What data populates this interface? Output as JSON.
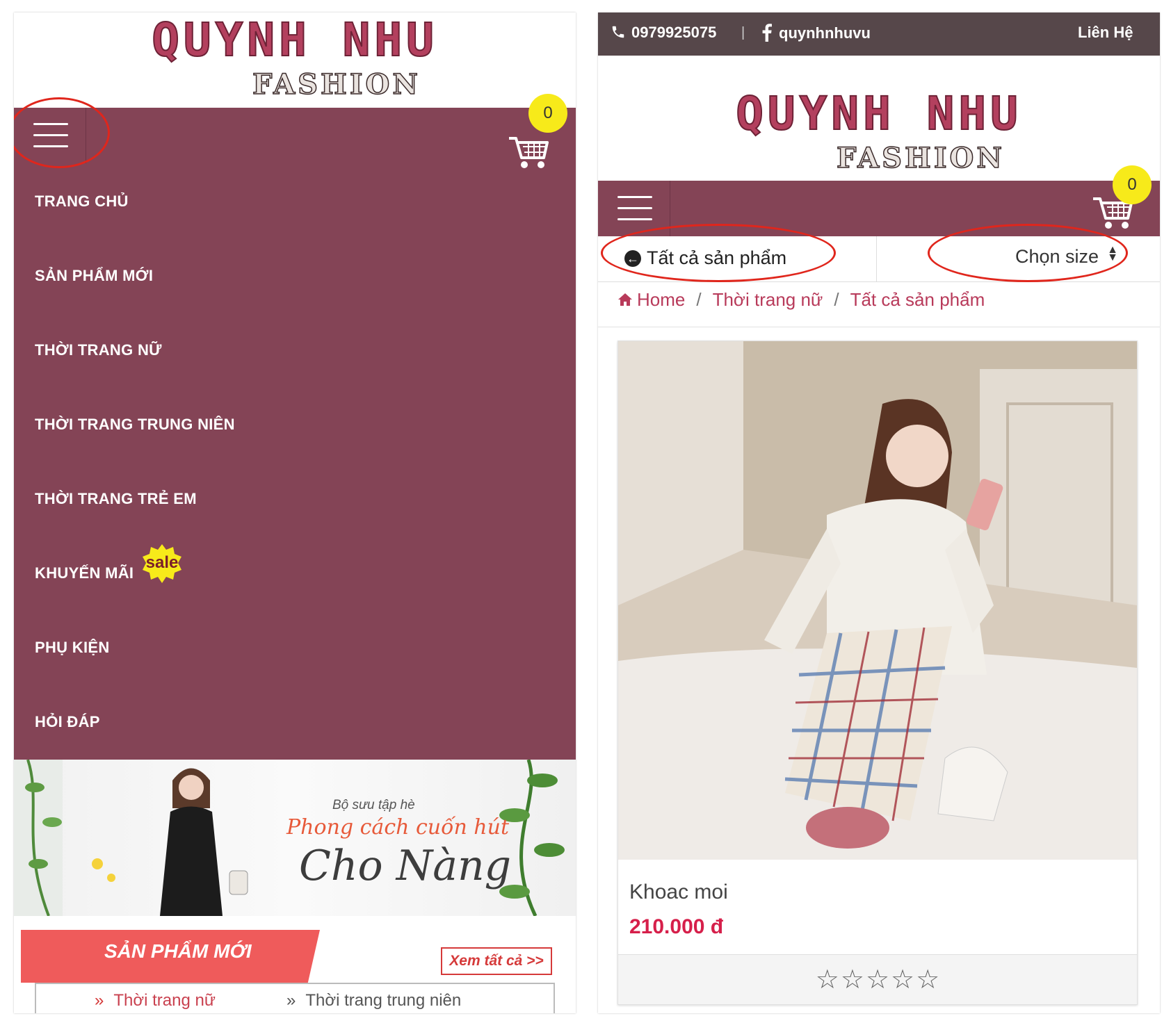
{
  "brand": {
    "logo_main": "QUYNH NHU",
    "logo_sub": "FASHION",
    "primary_color": "#844456",
    "accent_color": "#ef5b5b",
    "price_color": "#d61f4a"
  },
  "left": {
    "cart_count": "0",
    "menu": [
      {
        "label": "TRANG CHỦ"
      },
      {
        "label": "SẢN PHẨM MỚI"
      },
      {
        "label": "THỜI TRANG NỮ"
      },
      {
        "label": "THỜI TRANG TRUNG NIÊN"
      },
      {
        "label": "THỜI TRANG TRẺ EM"
      },
      {
        "label": "KHUYẾN MÃI",
        "badge": "sale"
      },
      {
        "label": "PHỤ KIỆN"
      },
      {
        "label": "HỎI ĐÁP"
      }
    ],
    "banner": {
      "kicker": "Bộ sưu tập hè",
      "line1": "Phong cách cuốn hút",
      "line2": "Cho Nàng"
    },
    "section": {
      "title": "SẢN PHẨM MỚI",
      "view_all": "Xem tất cả >>",
      "tabs": [
        {
          "label": "Thời trang nữ"
        },
        {
          "label": "Thời trang trung niên"
        }
      ]
    }
  },
  "right": {
    "topbar": {
      "phone": "0979925075",
      "facebook": "quynhnhuvu",
      "contact": "Liên Hệ"
    },
    "cart_count": "0",
    "filter": {
      "back_label": "Tất cả sản phẩm",
      "size_label": "Chọn size"
    },
    "breadcrumb": {
      "home": "Home",
      "category": "Thời trang nữ",
      "current": "Tất cả sản phẩm"
    },
    "product": {
      "name": "Khoac moi",
      "price": "210.000 đ",
      "rating_stars": 0,
      "rating_max": 5
    }
  }
}
